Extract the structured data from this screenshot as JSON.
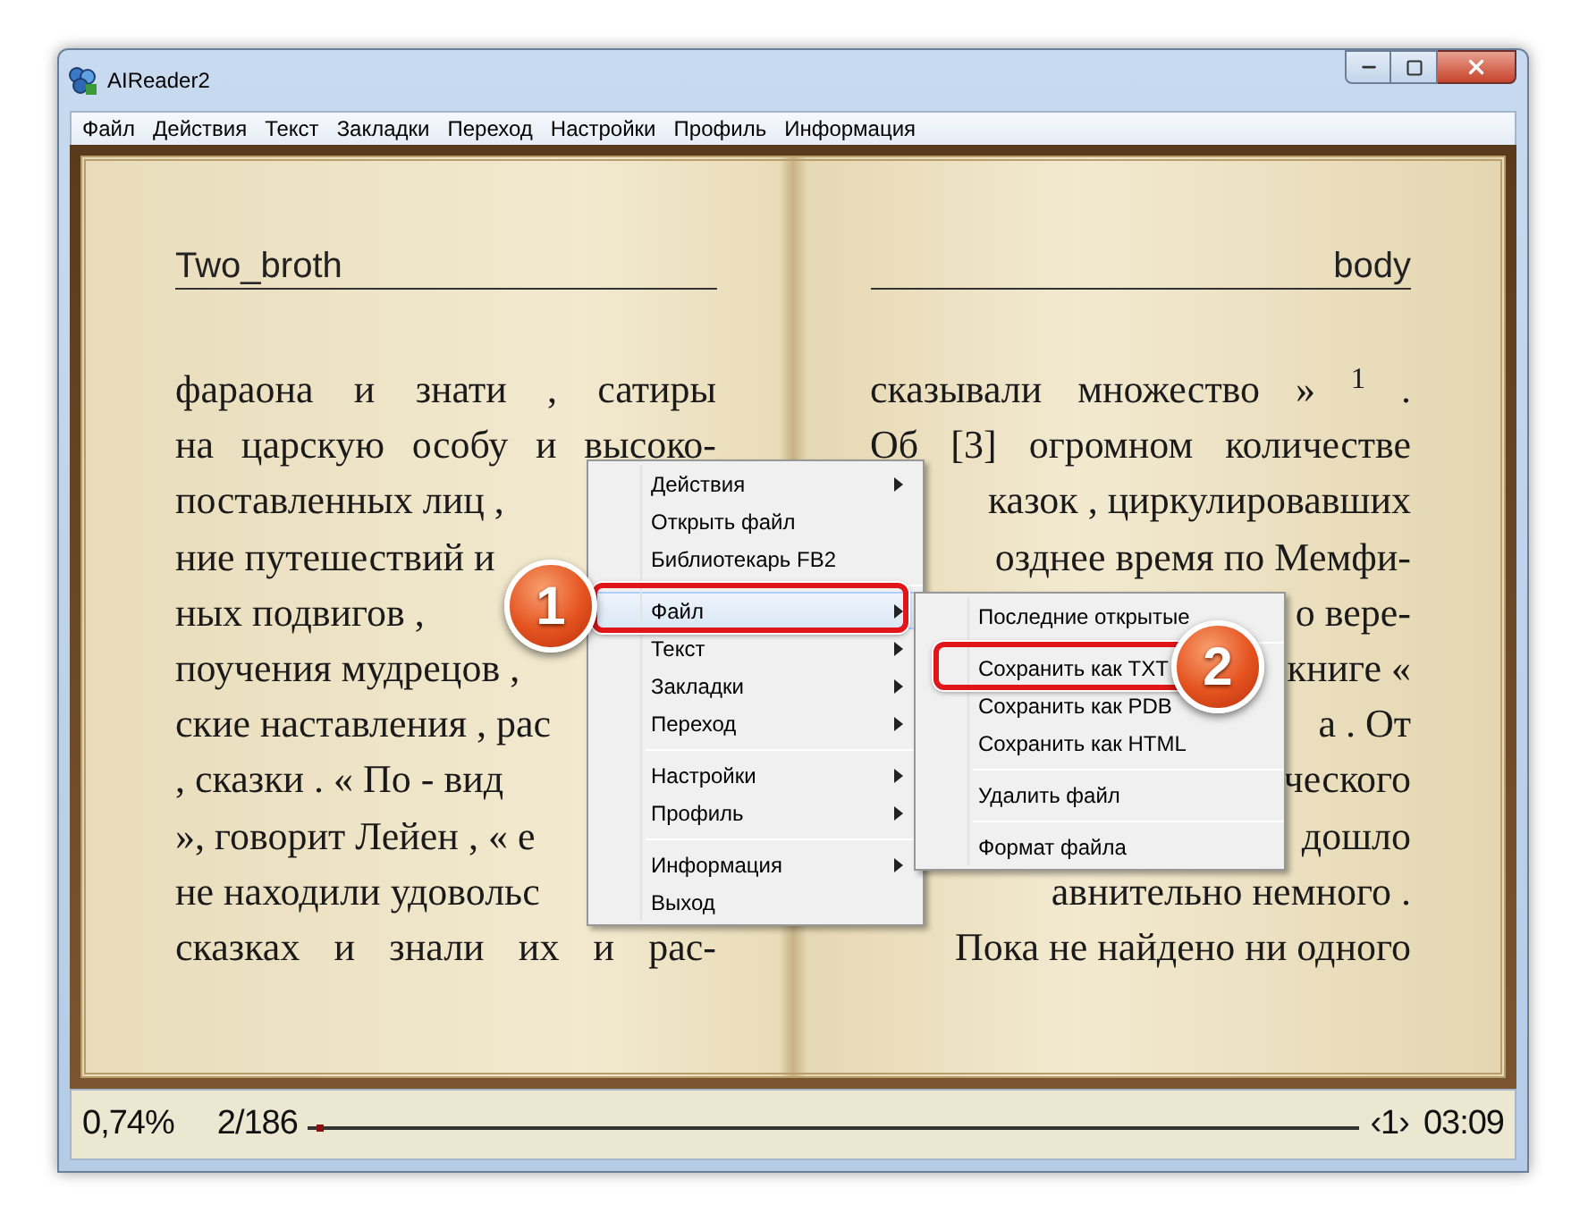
{
  "window": {
    "title": "AIReader2"
  },
  "menu_bar": [
    "Файл",
    "Действия",
    "Текст",
    "Закладки",
    "Переход",
    "Настройки",
    "Профиль",
    "Информация"
  ],
  "book": {
    "left_page": {
      "header": "Two_broth",
      "lines": [
        {
          "text": "фараона и знати , сатиры",
          "kind": "full"
        },
        {
          "text": "на царскую особу и высоко-",
          "kind": "full"
        },
        {
          "text": "поставленных лиц ,",
          "kind": "cut_end"
        },
        {
          "text": "ние путешествий и",
          "kind": "cut_end"
        },
        {
          "text": "ных подвигов ,",
          "kind": "cut_end"
        },
        {
          "text": "поучения мудрецов ,",
          "kind": "cut_end"
        },
        {
          "text": "ские наставления , рас",
          "kind": "cut_end"
        },
        {
          "text": ", сказки . « По - вид",
          "kind": "cut_end"
        },
        {
          "text": "», говорит Лейен , « е",
          "kind": "cut_end"
        },
        {
          "text": "не находили удовольс",
          "kind": "cut_end"
        },
        {
          "text": "сказках и знали их и рас-",
          "kind": "full"
        }
      ]
    },
    "right_page": {
      "header": "body",
      "lines": [
        {
          "text": "сказывали множество » $^{1}$ .",
          "kind": "full"
        },
        {
          "text": "Об [3] огромном количестве",
          "kind": "full"
        },
        {
          "text": "казок , циркулировавших",
          "kind": "cut_start"
        },
        {
          "text": "озднее время по Мемфи-",
          "kind": "cut_start"
        },
        {
          "text": "о вере-",
          "kind": "cut_start"
        },
        {
          "text": "книге «",
          "kind": "cut_start"
        },
        {
          "text": "а . От",
          "kind": "cut_start"
        },
        {
          "text": "ческого",
          "kind": "cut_start"
        },
        {
          "text": "дошло",
          "kind": "cut_start"
        },
        {
          "text": "авнительно немного .",
          "kind": "cut_start"
        },
        {
          "text": "Пока не найдено ни одного",
          "kind": "cut_start"
        }
      ]
    }
  },
  "context_menu": {
    "items": [
      {
        "label": "Действия",
        "submenu": true,
        "selected": false
      },
      {
        "label": "Открыть файл",
        "submenu": false,
        "selected": false
      },
      {
        "label": "Библиотекарь FB2",
        "submenu": false,
        "selected": false
      },
      {
        "kind": "separator"
      },
      {
        "label": "Файл",
        "submenu": true,
        "selected": true
      },
      {
        "label": "Текст",
        "submenu": true,
        "selected": false
      },
      {
        "label": "Закладки",
        "submenu": true,
        "selected": false
      },
      {
        "label": "Переход",
        "submenu": true,
        "selected": false
      },
      {
        "kind": "separator"
      },
      {
        "label": "Настройки",
        "submenu": true,
        "selected": false
      },
      {
        "label": "Профиль",
        "submenu": true,
        "selected": false
      },
      {
        "kind": "separator"
      },
      {
        "label": "Информация",
        "submenu": true,
        "selected": false
      },
      {
        "label": "Выход",
        "submenu": false,
        "selected": false
      }
    ]
  },
  "submenu": {
    "items": [
      {
        "label": "Последние открытые",
        "selected": false
      },
      {
        "kind": "separator"
      },
      {
        "label": "Сохранить как TXT",
        "selected": false
      },
      {
        "label": "Сохранить как PDB",
        "selected": false
      },
      {
        "label": "Сохранить как HTML",
        "selected": false
      },
      {
        "kind": "separator"
      },
      {
        "label": "Удалить файл",
        "selected": false
      },
      {
        "kind": "separator"
      },
      {
        "label": "Формат файла",
        "selected": false
      }
    ]
  },
  "callouts": [
    "1",
    "2"
  ],
  "status_bar": {
    "percent": "0,74%",
    "page": "2/186",
    "level": 0.0074,
    "chapter": "‹1›",
    "time": "03:09"
  }
}
